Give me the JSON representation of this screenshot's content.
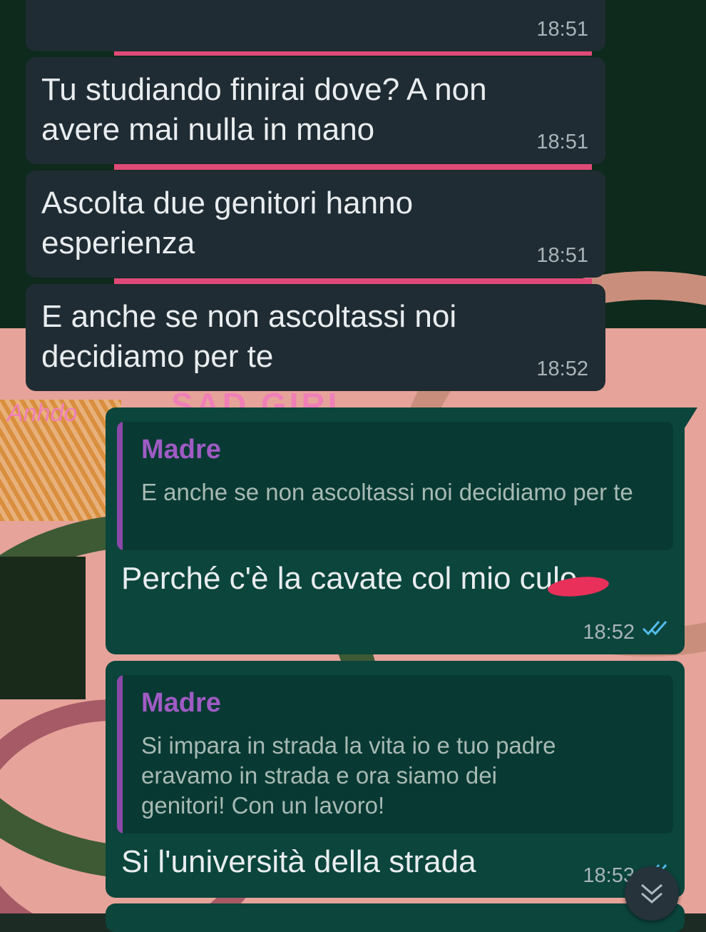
{
  "chat": {
    "messages": [
      {
        "type": "incoming",
        "text": "",
        "time": "18:51"
      },
      {
        "type": "incoming",
        "text": "Tu studiando finirai dove? A non avere mai nulla in mano",
        "time": "18:51"
      },
      {
        "type": "incoming",
        "text": "Ascolta due genitori hanno esperienza",
        "time": "18:51"
      },
      {
        "type": "incoming",
        "text": "E anche se non ascoltassi noi decidiamo per te",
        "time": "18:52"
      },
      {
        "type": "outgoing",
        "quote_author": "Madre",
        "quote_text": "E anche se non ascoltassi noi decidiamo per te",
        "text": "Perché c'è la cavate col mio culo",
        "time": "18:52",
        "status": "read"
      },
      {
        "type": "outgoing",
        "quote_author": "Madre",
        "quote_text": "Si impara in strada la vita io e tuo padre eravamo in strada e ora siamo dei genitori! Con un lavoro!",
        "text": "Si l'università della strada",
        "time": "18:53",
        "status": "read"
      }
    ]
  },
  "wallpaper": {
    "overlay_text_1": "SAD GIRL",
    "overlay_text_2": "Anhdo"
  },
  "colors": {
    "incoming_bubble": "#202c33",
    "outgoing_bubble": "#0b453c",
    "quote_author": "#a05bc4",
    "read_ticks": "#53bdeb"
  },
  "icons": {
    "read_receipt": "double-check-icon",
    "scroll_down": "chevron-double-down-icon"
  }
}
